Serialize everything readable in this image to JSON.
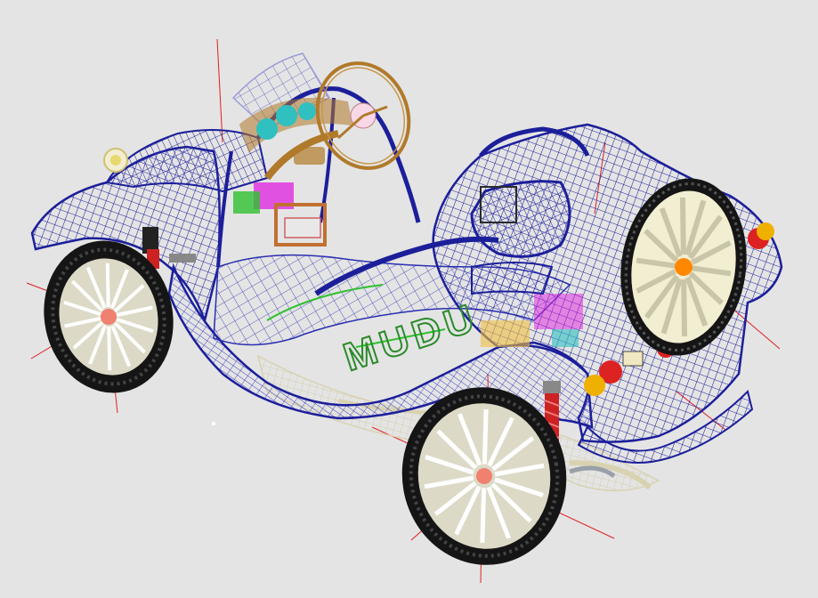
{
  "viewport": {
    "background": "#e4e4e4",
    "model": "wireframe-car",
    "render_mode": "wireframe"
  },
  "colors": {
    "body_wire": "#1c1f9a",
    "body_wire_light": "#3a3fc0",
    "axis_lines": "#e02020",
    "tire": "#151515",
    "rim": "#f2eed2",
    "rim_dark": "#c9c5a8",
    "hub": "#ff8800",
    "frame_beige": "#d8d2b0",
    "steering_wheel": "#b07a2a",
    "dashboard_gauge": "#30c0c0",
    "seat_green": "#2a8a2a",
    "shock_red": "#cc2222",
    "lamp_red": "#dd2222",
    "lamp_yellow": "#f0b000",
    "parts_magenta": "#e020e0",
    "parts_green": "#30c030"
  },
  "lettering": "MUDU"
}
